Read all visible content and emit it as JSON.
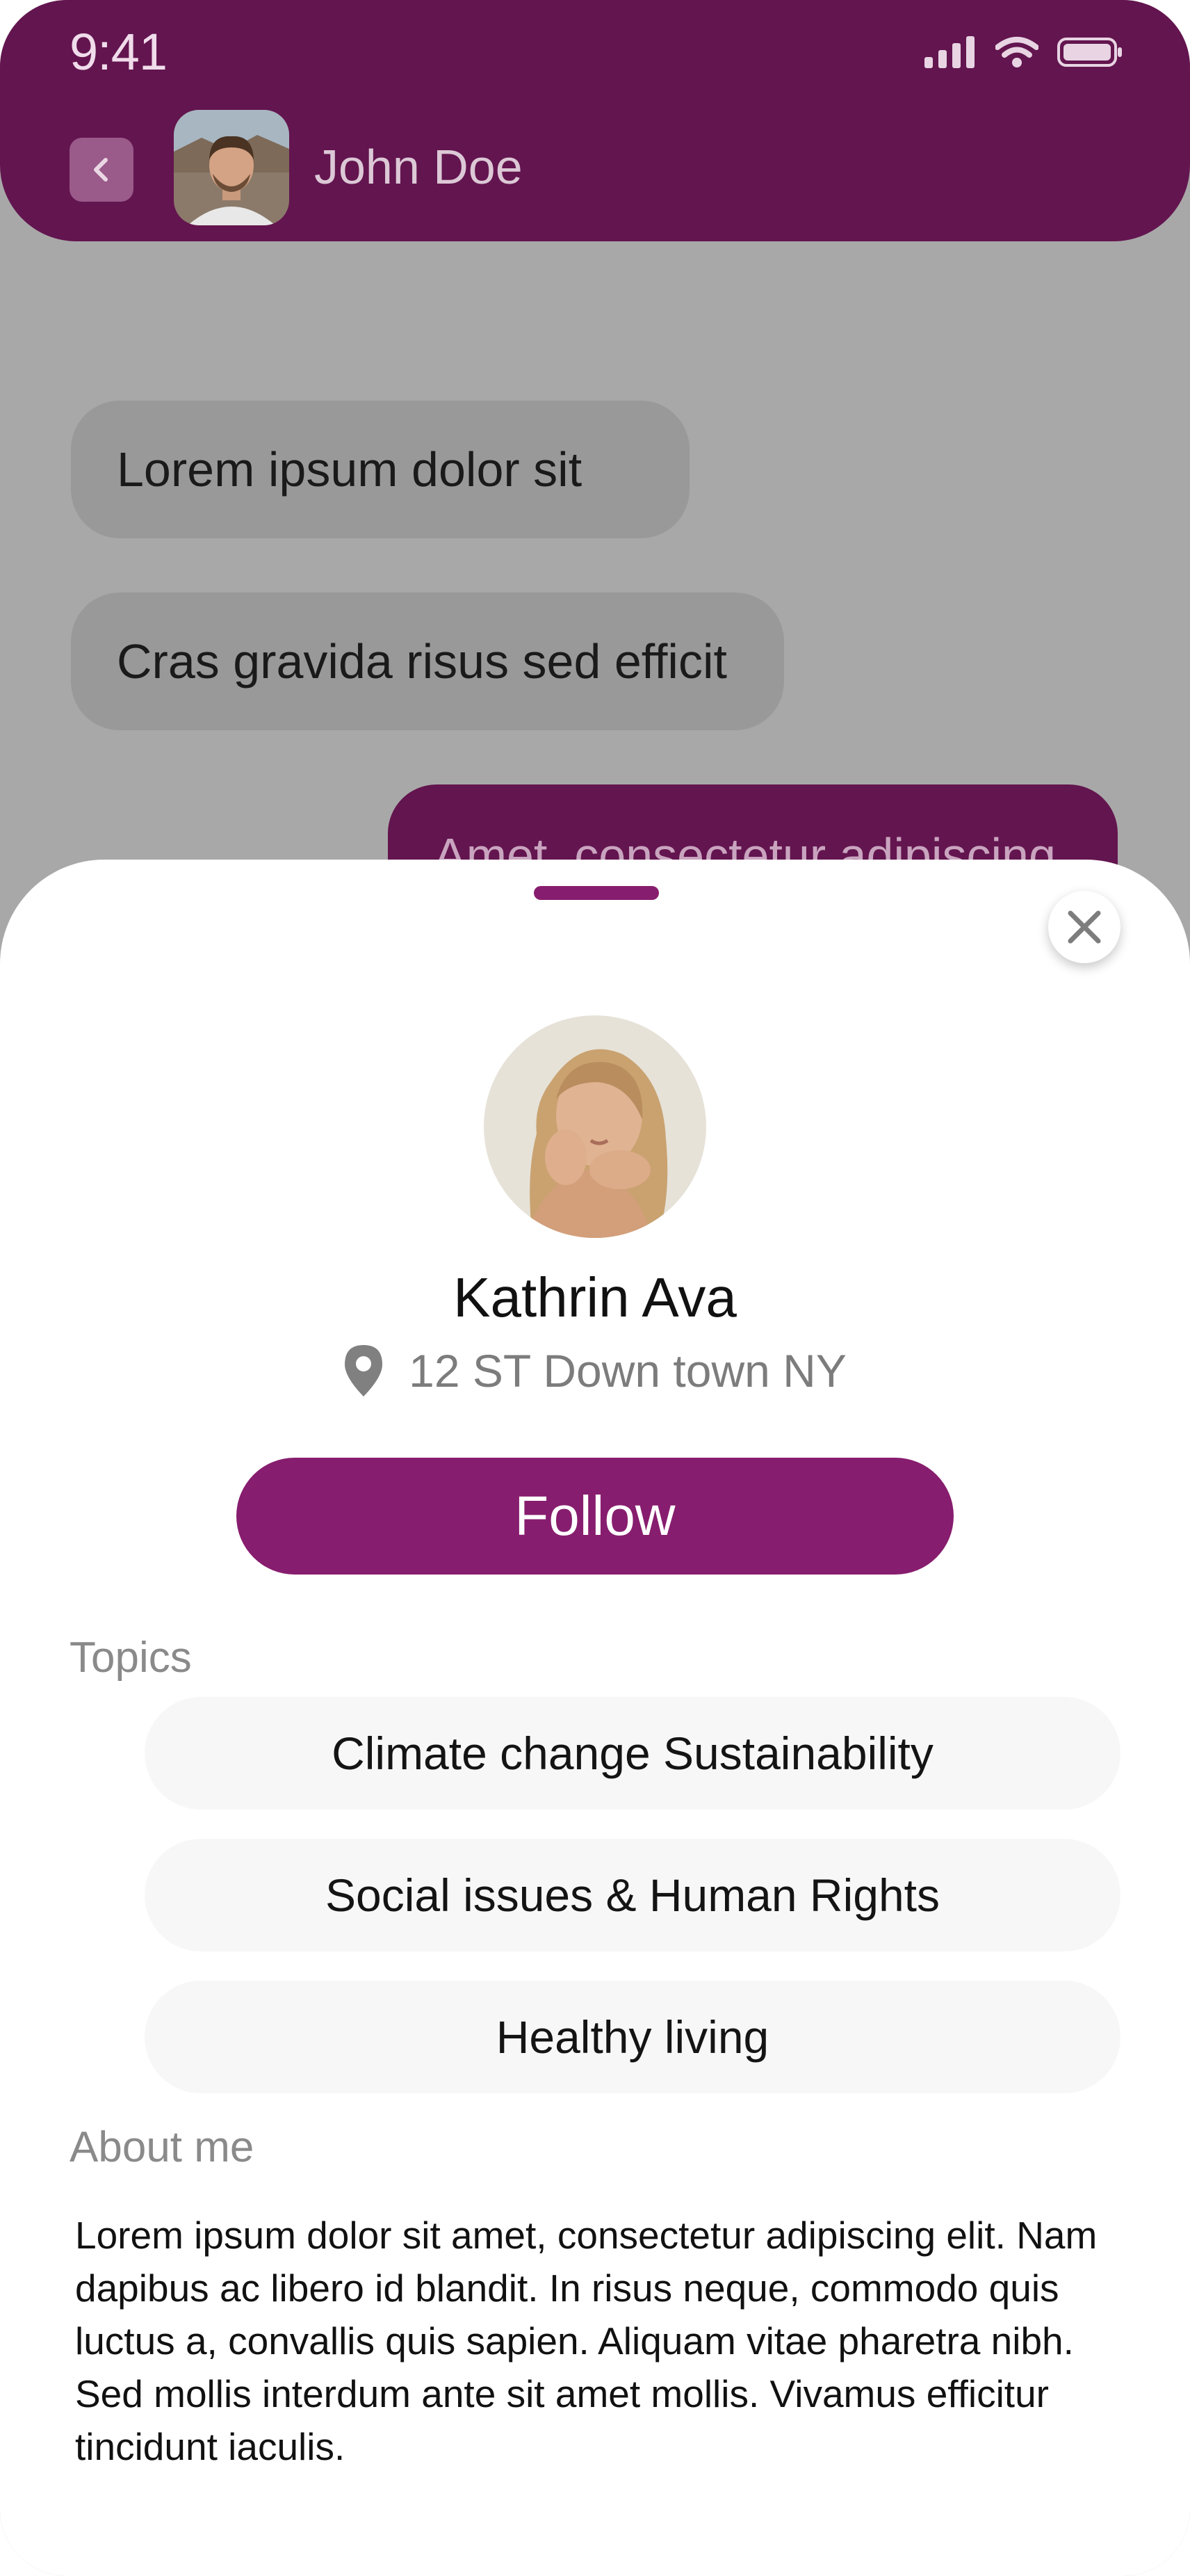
{
  "status_bar": {
    "time": "9:41",
    "icons": [
      "cellular-signal-icon",
      "wifi-icon",
      "battery-icon"
    ]
  },
  "chat_header": {
    "back_icon": "chevron-left-icon",
    "contact_name": "John Doe"
  },
  "messages": [
    {
      "text": "Lorem ipsum dolor sit",
      "direction": "incoming"
    },
    {
      "text": "Cras gravida risus sed efficit",
      "direction": "incoming"
    },
    {
      "text": "Amet, consectetur adipiscing",
      "direction": "outgoing"
    }
  ],
  "profile_sheet": {
    "close_icon": "close-icon",
    "name": "Kathrin Ava",
    "location_icon": "map-pin-icon",
    "location": "12 ST Down town NY",
    "follow_label": "Follow",
    "topics_label": "Topics",
    "topics": [
      "Climate change Sustainability",
      "Social issues & Human Rights",
      "Healthy living"
    ],
    "about_label": "About me",
    "about_text": "Lorem ipsum dolor sit amet, consectetur adipiscing elit. Nam dapibus ac libero id blandit. In risus neque, commodo quis luctus a, convallis quis sapien. Aliquam vitae pharetra nibh. Sed mollis interdum ante sit amet mollis. Vivamus efficitur tincidunt iaculis."
  },
  "colors": {
    "header": "#63154f",
    "accent": "#871d6e",
    "overlay": "#a8a8a8",
    "topic_chip": "#f7f7f7"
  }
}
